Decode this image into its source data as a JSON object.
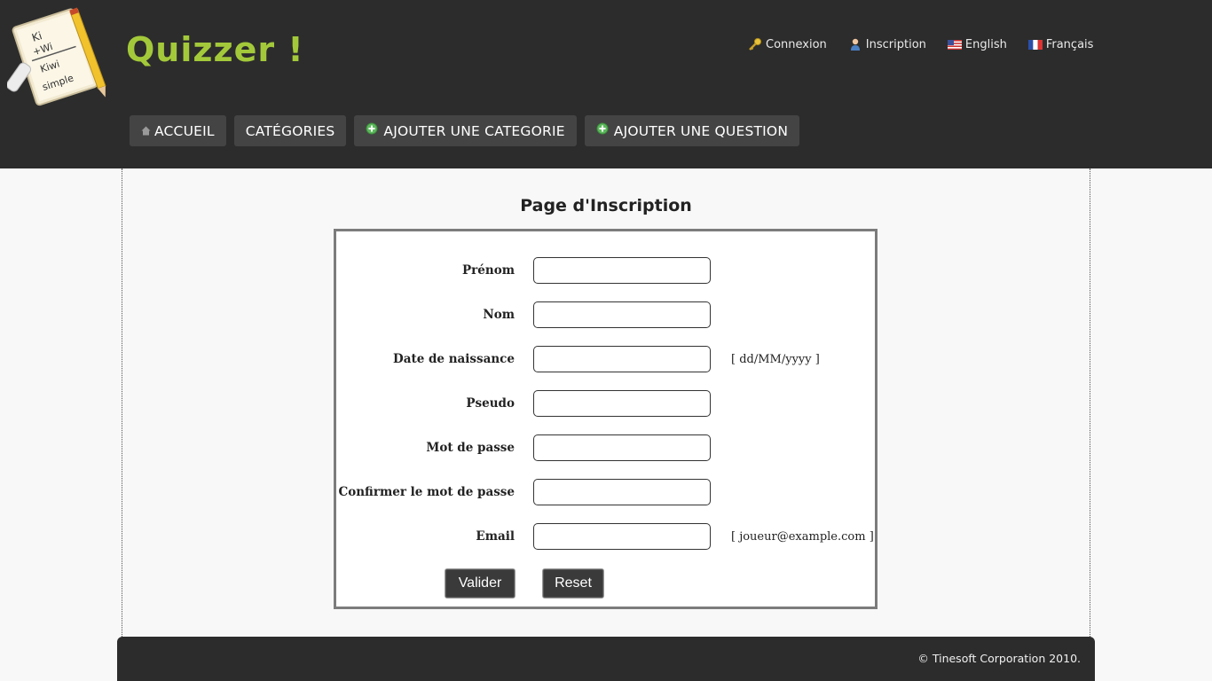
{
  "header": {
    "site_title": "Quizzer !",
    "logo_lines": [
      "Ki",
      "+Wi",
      "Kiwi",
      "simple"
    ],
    "top_links": [
      {
        "label": "Connexion",
        "icon": "key-icon"
      },
      {
        "label": "Inscription",
        "icon": "user-icon"
      },
      {
        "label": "English",
        "icon": "us-flag-icon"
      },
      {
        "label": "Français",
        "icon": "fr-flag-icon"
      }
    ],
    "nav": [
      {
        "label": "ACCUEIL",
        "icon": "home-icon"
      },
      {
        "label": "CATÉGORIES",
        "icon": ""
      },
      {
        "label": "AJOUTER UNE CATEGORIE",
        "icon": "add-icon"
      },
      {
        "label": "AJOUTER UNE QUESTION",
        "icon": "add-icon"
      }
    ]
  },
  "form": {
    "title": "Page d'Inscription",
    "fields": [
      {
        "label": "Prénom",
        "value": "",
        "hint": ""
      },
      {
        "label": "Nom",
        "value": "",
        "hint": ""
      },
      {
        "label": "Date de naissance",
        "value": "",
        "hint": "[ dd/MM/yyyy ]"
      },
      {
        "label": "Pseudo",
        "value": "",
        "hint": ""
      },
      {
        "label": "Mot de passe",
        "value": "",
        "hint": ""
      },
      {
        "label": "Confirmer le mot de passe",
        "value": "",
        "hint": ""
      },
      {
        "label": "Email",
        "value": "",
        "hint": "[ joueur@example.com ]"
      }
    ],
    "submit_label": "Valider",
    "reset_label": "Reset"
  },
  "footer": {
    "copyright": "© Tinesoft Corporation 2010."
  },
  "colors": {
    "header_bg": "#2c2c2c",
    "title_green": "#a3c93a",
    "nav_button_bg": "#444444",
    "form_border": "#7c7c7c"
  }
}
